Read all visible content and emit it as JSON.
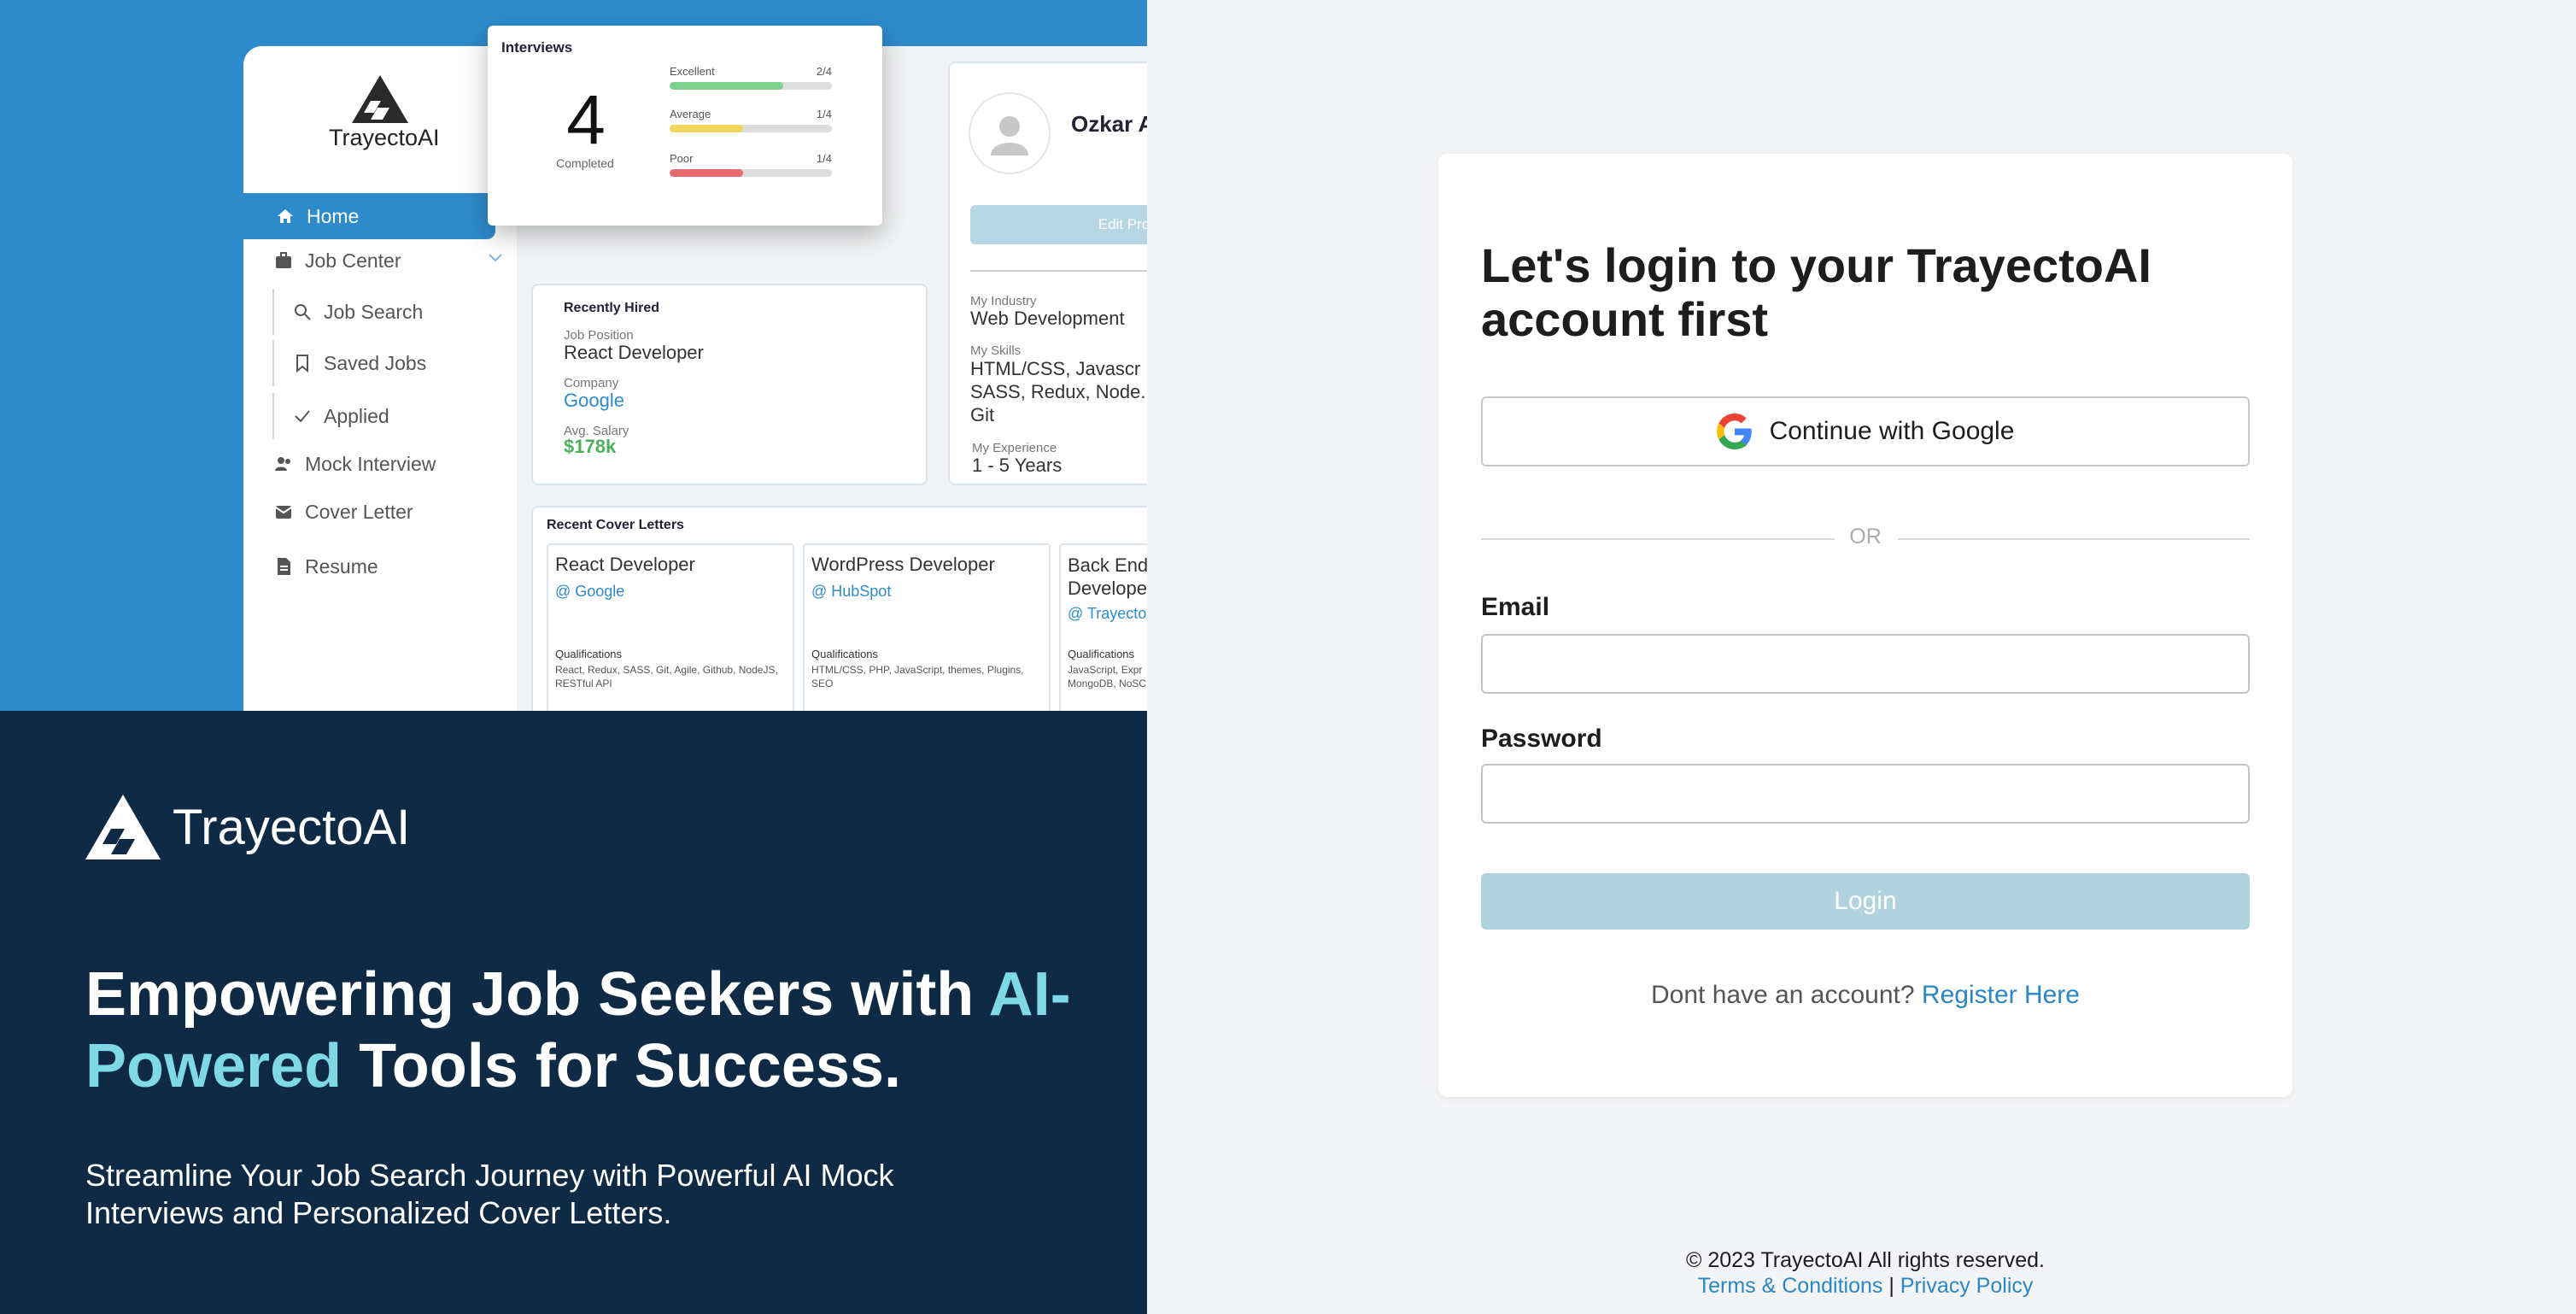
{
  "brand": {
    "name": "TrayectoAI"
  },
  "hero": {
    "headline_part1": "Empowering Job Seekers with ",
    "headline_highlight": "AI-Powered",
    "headline_part2": " Tools for Success.",
    "subtitle": "Streamline Your Job Search Journey with Powerful AI Mock Interviews and Personalized Cover Letters."
  },
  "mock": {
    "logo_text": "TrayectoAI",
    "nav": {
      "home": "Home",
      "job_center": "Job Center",
      "job_search": "Job Search",
      "saved_jobs": "Saved Jobs",
      "applied": "Applied",
      "mock_interview": "Mock Interview",
      "cover_letter": "Cover Letter",
      "resume": "Resume"
    },
    "interviews": {
      "title": "Interviews",
      "count": "4",
      "count_label": "Completed",
      "rows": [
        {
          "label": "Excellent",
          "count": "2/4",
          "fraction": 0.7,
          "color": "#7ed08d"
        },
        {
          "label": "Average",
          "count": "1/4",
          "fraction": 0.45,
          "color": "#f0d65a"
        },
        {
          "label": "Poor",
          "count": "1/4",
          "fraction": 0.45,
          "color": "#e66a6e"
        }
      ]
    },
    "recently_hired": {
      "title": "Recently Hired",
      "position_label": "Job Position",
      "position": "React Developer",
      "company_label": "Company",
      "company": "Google",
      "salary_label": "Avg. Salary",
      "salary": "$178k"
    },
    "profile": {
      "name": "Ozkar A",
      "edit_button": "Edit Pro",
      "industry_label": "My Industry",
      "industry": "Web Development",
      "skills_label": "My Skills",
      "skills": "HTML/CSS, Javascr SASS, Redux, Node. Git",
      "experience_label": "My Experience",
      "experience": "1 - 5 Years"
    },
    "cover_letters": {
      "title": "Recent Cover Letters",
      "items": [
        {
          "role": "React Developer",
          "company": "@ Google",
          "qual_label": "Qualifications",
          "quals": "React, Redux, SASS, Git, Agile, Github, NodeJS, RESTful API"
        },
        {
          "role": "WordPress Developer",
          "company": "@ HubSpot",
          "qual_label": "Qualifications",
          "quals": "HTML/CSS, PHP, JavaScript, themes, Plugins, SEO"
        },
        {
          "role": "Back End Develope",
          "company": "@ Trayecto",
          "qual_label": "Qualifications",
          "quals": "JavaScript, Expr MongoDB, NoSC"
        }
      ]
    }
  },
  "login": {
    "title": "Let's login to your TrayectoAI account first",
    "google_button": "Continue with Google",
    "divider": "OR",
    "email_label": "Email",
    "email_value": "",
    "password_label": "Password",
    "password_value": "",
    "submit": "Login",
    "register_prompt": "Dont have an account?",
    "register_link": "Register Here"
  },
  "footer": {
    "copyright": "© 2023 TrayectoAI All rights reserved.",
    "terms": "Terms & Conditions",
    "separator": "|",
    "privacy": "Privacy Policy"
  },
  "colors": {
    "accent": "#2d8bcb",
    "navy": "#0f2a45",
    "highlight": "#7fd8e6",
    "login_button": "#b1d3de"
  }
}
